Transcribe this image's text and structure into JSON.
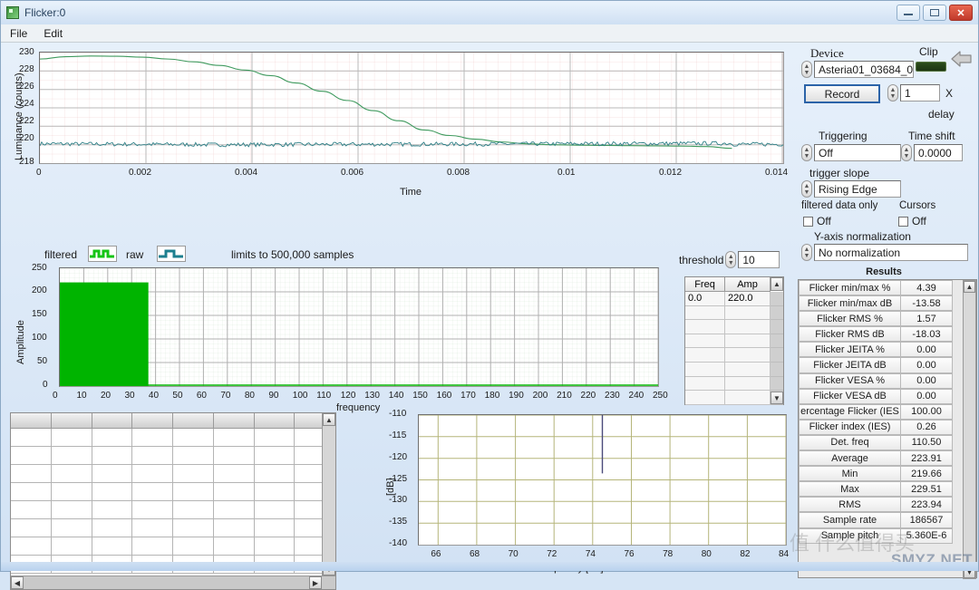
{
  "window": {
    "title": "Flicker:0",
    "icon": "app-icon",
    "buttons": {
      "minimize": "–",
      "maximize": "□",
      "close": "✕"
    }
  },
  "menu": {
    "items": [
      "File",
      "Edit"
    ]
  },
  "device_panel": {
    "device_label": "Device",
    "device_value": "Asteria01_03684_0",
    "clip_label": "Clip",
    "record_label": "Record",
    "multiplier_value": "1",
    "multiplier_unit": "X",
    "delay_label": "delay"
  },
  "trigger_panel": {
    "triggering_label": "Triggering",
    "triggering_value": "Off",
    "time_shift_label": "Time shift",
    "time_shift_value": "0.0000",
    "trigger_slope_label": "trigger slope",
    "trigger_slope_value": "Rising Edge",
    "filtered_only_label": "filtered data only",
    "filtered_only_value": "Off",
    "cursors_label": "Cursors",
    "cursors_value": "Off",
    "y_norm_label": "Y-axis normalization",
    "y_norm_value": "No normalization"
  },
  "results": {
    "title": "Results",
    "rows": [
      {
        "name": "Flicker min/max %",
        "value": "4.39"
      },
      {
        "name": "Flicker min/max dB",
        "value": "-13.58"
      },
      {
        "name": "Flicker RMS %",
        "value": "1.57"
      },
      {
        "name": "Flicker RMS dB",
        "value": "-18.03"
      },
      {
        "name": "Flicker JEITA %",
        "value": "0.00"
      },
      {
        "name": "Flicker JEITA dB",
        "value": "0.00"
      },
      {
        "name": "Flicker VESA %",
        "value": "0.00"
      },
      {
        "name": "Flicker VESA dB",
        "value": "0.00"
      },
      {
        "name": "ercentage Flicker (IES",
        "value": "100.00"
      },
      {
        "name": "Flicker index (IES)",
        "value": "0.26"
      },
      {
        "name": "Det. freq",
        "value": "110.50"
      },
      {
        "name": "Average",
        "value": "223.91"
      },
      {
        "name": "Min",
        "value": "219.66"
      },
      {
        "name": "Max",
        "value": "229.51"
      },
      {
        "name": "RMS",
        "value": "223.94"
      },
      {
        "name": "Sample rate",
        "value": "186567"
      },
      {
        "name": "Sample pitch",
        "value": "5.360E-6"
      }
    ]
  },
  "spectrum_panel": {
    "legend_filtered": "filtered",
    "legend_raw": "raw",
    "limits_note": "limits to 500,000 samples",
    "threshold_label": "threshold",
    "threshold_value": "10",
    "peak_table": {
      "columns": [
        "Freq",
        "Amp"
      ],
      "rows": [
        [
          "0.0",
          "220.0"
        ]
      ]
    }
  },
  "watermark": {
    "text": "SMYZ.NET",
    "cn": "值 什么值得买"
  },
  "chart_data": [
    {
      "type": "line",
      "name": "luminance-time-plot",
      "title": "",
      "xlabel": "Time",
      "ylabel": "Luminance (counts)",
      "xlim": [
        0,
        0.0145
      ],
      "ylim": [
        218,
        230
      ],
      "xticks": [
        "0",
        "0.002",
        "0.004",
        "0.006",
        "0.008",
        "0.01",
        "0.012",
        "0.014"
      ],
      "yticks": [
        "218",
        "220",
        "222",
        "224",
        "226",
        "228",
        "230"
      ],
      "grid": true,
      "legend": [
        "filtered",
        "raw"
      ],
      "series": [
        {
          "name": "filtered",
          "color": "#3f9a5e",
          "x": [
            0,
            0.0005,
            0.001,
            0.0015,
            0.002,
            0.0025,
            0.003,
            0.0035,
            0.004,
            0.0045,
            0.005,
            0.0055,
            0.006,
            0.0065,
            0.007,
            0.0075,
            0.008,
            0.0085,
            0.009,
            0.0095,
            0.01,
            0.0105,
            0.011,
            0.0115,
            0.012,
            0.0125,
            0.013,
            0.0135
          ],
          "y": [
            229.3,
            229.55,
            229.62,
            229.6,
            229.5,
            229.3,
            229.0,
            228.6,
            228.1,
            227.5,
            226.7,
            225.8,
            224.8,
            223.7,
            222.6,
            221.6,
            221.0,
            220.6,
            220.3,
            220.1,
            220.0,
            219.95,
            219.92,
            219.9,
            219.88,
            219.85,
            219.8,
            219.6
          ]
        },
        {
          "name": "raw",
          "color": "#2d7f86",
          "x": [
            0,
            0.0035,
            0.007,
            0.0105,
            0.0135
          ],
          "y": [
            220.1,
            220.0,
            220.05,
            220.1,
            220.15
          ],
          "noise": 0.22
        }
      ]
    },
    {
      "type": "bar",
      "name": "amplitude-frequency-plot",
      "title": "",
      "xlabel": "frequency",
      "ylabel": "Amplitude",
      "xlim": [
        0,
        250
      ],
      "ylim": [
        0,
        250
      ],
      "xticks": [
        "0",
        "10",
        "20",
        "30",
        "40",
        "50",
        "60",
        "70",
        "80",
        "90",
        "100",
        "110",
        "120",
        "130",
        "140",
        "150",
        "160",
        "170",
        "180",
        "190",
        "200",
        "210",
        "220",
        "230",
        "240",
        "250"
      ],
      "yticks": [
        "0",
        "50",
        "100",
        "150",
        "200",
        "250"
      ],
      "grid": true,
      "color": "#00b400",
      "categories": [
        0,
        37
      ],
      "values": [
        220,
        220
      ],
      "note": "solid green block from 0 Hz to ~37 Hz at amplitude 220; baseline ~0 beyond"
    },
    {
      "type": "line",
      "name": "db-frequency-plot",
      "title": "",
      "xlabel": "Frequency [Hz]",
      "ylabel": "[dB]",
      "xlim": [
        65,
        84
      ],
      "ylim": [
        -140,
        -110
      ],
      "xticks": [
        "66",
        "68",
        "70",
        "72",
        "74",
        "76",
        "78",
        "80",
        "82",
        "84"
      ],
      "yticks": [
        "-110",
        "-115",
        "-120",
        "-125",
        "-130",
        "-135",
        "-140"
      ],
      "grid": true,
      "color": "#4a4a7a",
      "peaks": [
        {
          "freq": 74.5,
          "db": -123.5
        }
      ]
    }
  ],
  "data_grid": {
    "columns": 8,
    "rows": 8,
    "cells": []
  }
}
